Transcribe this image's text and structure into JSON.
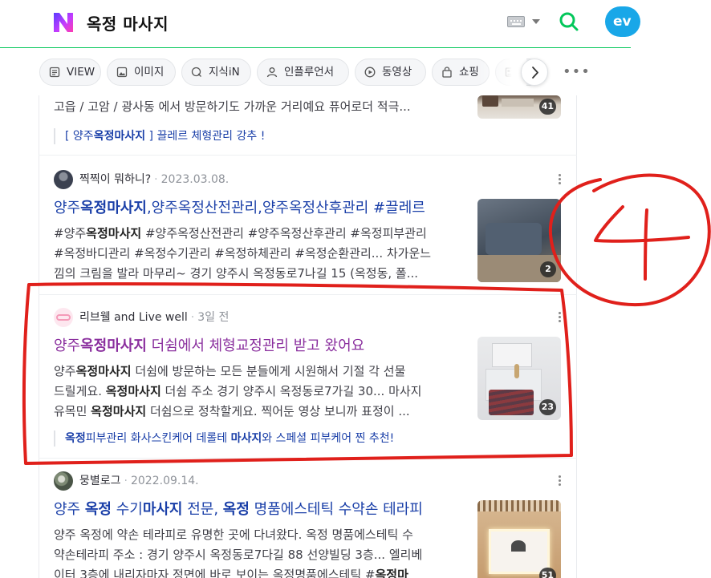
{
  "header": {
    "query": "옥정 마사지",
    "profile_text": "ev",
    "colors": {
      "brand_green": "#03c75a",
      "profile_blue": "#19a7e8"
    }
  },
  "tabs": [
    {
      "label": "VIEW",
      "icon": "document-icon"
    },
    {
      "label": "이미지",
      "icon": "image-icon"
    },
    {
      "label": "지식iN",
      "icon": "qna-icon"
    },
    {
      "label": "인플루언서",
      "icon": "person-icon"
    },
    {
      "label": "동영상",
      "icon": "play-icon"
    },
    {
      "label": "쇼핑",
      "icon": "bag-icon"
    }
  ],
  "results": [
    {
      "desc_line": "고읍 / 고암 / 광사동 에서 방문하기도 가까운 거리예요 퓨어로더 적극...",
      "image_count": "41",
      "sub_link_pre": "[ 양주",
      "sub_link_bold": "옥정마사지",
      "sub_link_post": " ] 끌레르 체형관리 강추 !"
    },
    {
      "author": "찍찍이 뭐하니?",
      "date": "2023.03.08.",
      "title_pre": "양주",
      "title_bold": "옥정마사지",
      "title_post": ",양주옥정산전관리,양주옥정산후관리 #끌레르",
      "desc1_pre": "#양주",
      "desc1_bold": "옥정마사지",
      "desc1_post": " #양주옥정산전관리 #양주옥정산후관리 #옥정피부관리",
      "desc2": "#옥정바디관리 #옥정수기관리 #옥정하체관리 #옥정순환관리... 차가운느",
      "desc3": "낌의 크림을 발라 마무리~ 경기 양주시 옥정동로7나길 15 (옥정동, 폴...",
      "image_count": "2"
    },
    {
      "author": "리브웰 and Live well",
      "date": "3일 전",
      "title_pre": "양주",
      "title_bold": "옥정마사지",
      "title_post": " 더쉼에서 체형교정관리 받고 왔어요",
      "desc1_pre": "양주",
      "desc1_bold": "옥정마사지",
      "desc1_post": " 더쉼에 방문하는 모든 분들에게 시원해서 기절 각 선물",
      "desc2_pre": "드릴게요. ",
      "desc2_bold": "옥정마사지",
      "desc2_post": " 더쉼 주소 경기 양주시 옥정동로7가길 30... 마사지",
      "desc3_pre": "유목민 ",
      "desc3_bold": "옥정마사지",
      "desc3_post": " 더쉼으로 정착할게요. 찍어둔 영상 보니까 표정이 ...",
      "image_count": "23",
      "sub_link_bold1": "옥정",
      "sub_link_mid": "피부관리 화사스킨케어 데롤테 ",
      "sub_link_bold2": "마사지",
      "sub_link_post": "와 스페셜 피부케어 찐 추천!"
    },
    {
      "author": "뭉별로그",
      "date": "2022.09.14.",
      "title_pre": "양주 ",
      "title_bold1": "옥정",
      "title_mid1": " 수기",
      "title_bold2": "마사지",
      "title_mid2": " 전문, ",
      "title_bold3": "옥정",
      "title_post": " 명품에스테틱 수약손 테라피",
      "desc1": "양주 옥정에 약손 테라피로 유명한 곳에 다녀왔다. 옥정 명품에스테틱 수",
      "desc2": "약손테라피 주소 : 경기 양주시 옥정동로7다길 88 선양빌딩 3층... 엘리베",
      "desc3_pre": "이터 3층에 내리자마자 정면에 바로 보이는 옥정명품에스테틱 #",
      "desc3_bold": "옥정마",
      "image_count": "51"
    }
  ],
  "annotation": {
    "number": "4",
    "color": "#e0201b"
  }
}
